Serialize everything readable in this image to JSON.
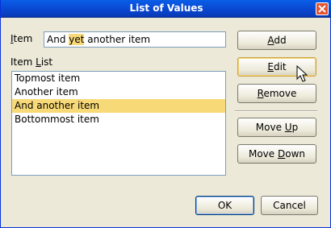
{
  "window": {
    "title": "List of Values"
  },
  "item": {
    "label_mnemonic": "I",
    "label_rest": "tem",
    "value_before": "And ",
    "value_highlight": "yet",
    "value_after": " another item"
  },
  "item_list": {
    "label_before": "Item ",
    "label_mnemonic": "L",
    "label_after": "ist",
    "items": [
      "Topmost item",
      "Another item",
      "And another item",
      "Bottommost item"
    ],
    "selected": "And another item"
  },
  "buttons": {
    "add": {
      "mnemonic": "A",
      "rest": "dd"
    },
    "edit": {
      "mnemonic": "E",
      "rest": "dit"
    },
    "remove": {
      "mnemonic": "R",
      "rest": "emove"
    },
    "move_up": {
      "before": "Move ",
      "mnemonic": "U",
      "after": "p"
    },
    "move_down": {
      "before": "Move ",
      "mnemonic": "D",
      "after": "own"
    },
    "ok": "OK",
    "cancel": "Cancel"
  },
  "colors": {
    "highlight": "#f8d978",
    "titlebar": "#0a46cf",
    "dialog_bg": "#ece9d8"
  }
}
